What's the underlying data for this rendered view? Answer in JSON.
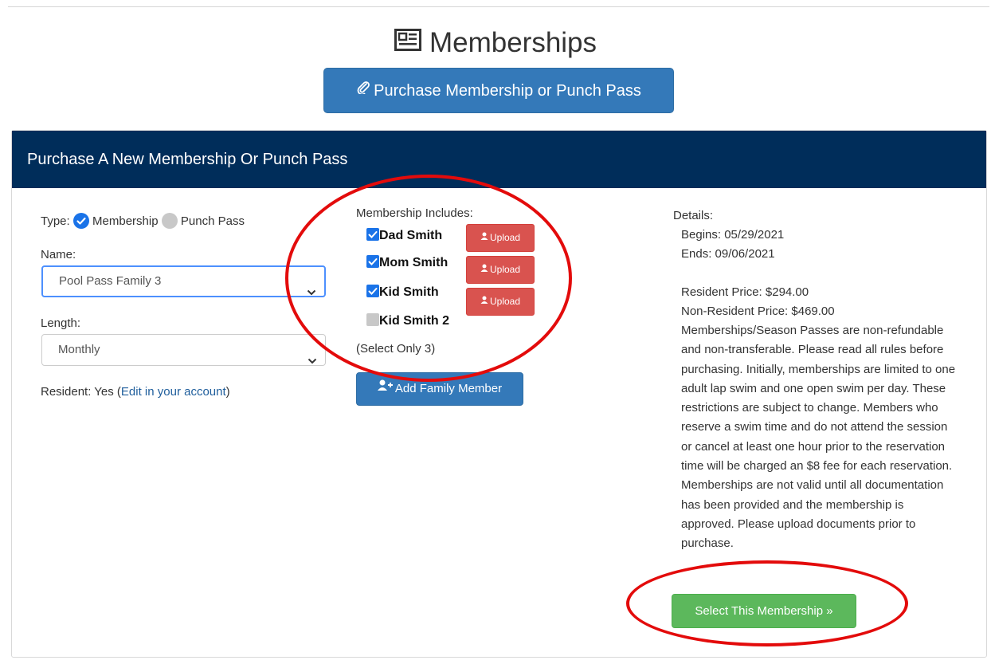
{
  "header": {
    "title": "Memberships",
    "purchase_button": "Purchase Membership or Punch Pass"
  },
  "panel": {
    "heading": "Purchase A New Membership Or Punch Pass"
  },
  "form": {
    "type_label": "Type:",
    "type_options": [
      {
        "label": "Membership",
        "selected": true
      },
      {
        "label": "Punch Pass",
        "selected": false
      }
    ],
    "name_label": "Name:",
    "name_value": "Pool Pass Family 3",
    "length_label": "Length:",
    "length_value": "Monthly",
    "resident_prefix": "Resident: Yes (",
    "resident_link": "Edit in your account",
    "resident_suffix": ")"
  },
  "membership": {
    "includes_label": "Membership Includes:",
    "members": [
      {
        "name": "Dad Smith",
        "checked": true,
        "upload_label": "Upload"
      },
      {
        "name": "Mom Smith",
        "checked": true,
        "upload_label": "Upload"
      },
      {
        "name": "Kid Smith",
        "checked": true,
        "upload_label": "Upload"
      },
      {
        "name": "Kid Smith 2",
        "checked": false
      }
    ],
    "select_note": "(Select Only 3)",
    "add_button": "Add Family Member"
  },
  "details": {
    "label": "Details:",
    "begins": "Begins: 05/29/2021",
    "ends": "Ends: 09/06/2021",
    "resident_price": "Resident Price: $294.00",
    "nonresident_price": "Non-Resident Price: $469.00",
    "description": "Memberships/Season Passes are non-refundable and non-transferable. Please read all rules before purchasing. Initially, memberships are limited to one adult lap swim and one open swim per day. These restrictions are subject to change. Members who reserve a swim time and do not attend the session or cancel at least one hour prior to the reservation time will be charged an $8 fee for each reservation. Memberships are not valid until all documentation has been provided and the membership is approved. Please upload documents prior to purchase.",
    "select_button": "Select This Membership »"
  },
  "colors": {
    "navy": "#002d5a",
    "primary": "#3479b9",
    "danger": "#d9534f",
    "success": "#5cb85c",
    "annotation": "#e30b0b"
  }
}
